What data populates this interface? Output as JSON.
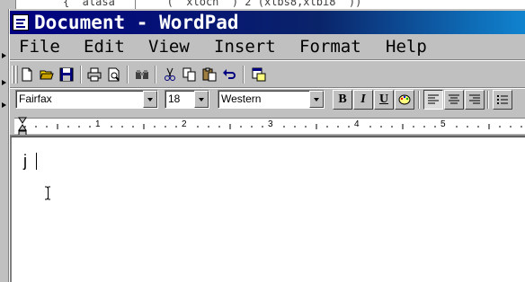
{
  "background": {
    "code_fragment": "{  alasa        (  xlocn  ) 2 (xlbs8,xlbi8  ))"
  },
  "window": {
    "title": "Document - WordPad",
    "title_bar_color": "#000080"
  },
  "menu": {
    "items": [
      "File",
      "Edit",
      "View",
      "Insert",
      "Format",
      "Help"
    ]
  },
  "toolbar": {
    "buttons": [
      "new-icon",
      "open-icon",
      "save-icon",
      "print-icon",
      "print-preview-icon",
      "find-icon",
      "cut-icon",
      "copy-icon",
      "paste-icon",
      "undo-icon",
      "insert-datetime-icon"
    ]
  },
  "format": {
    "font": "Fairfax",
    "size": "18",
    "script": "Western",
    "bold": "B",
    "italic": "I",
    "underline": "U"
  },
  "ruler": {
    "numbers": [
      "1",
      "2",
      "3",
      "4",
      "5"
    ]
  },
  "document": {
    "text": "j"
  }
}
